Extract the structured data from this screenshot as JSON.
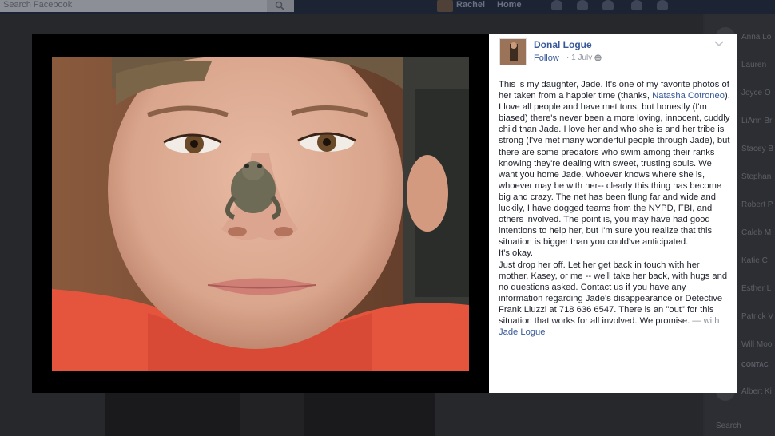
{
  "topbar": {
    "search_placeholder": "Search Facebook",
    "user_name": "Rachel",
    "home_label": "Home"
  },
  "post": {
    "author": "Donal Logue",
    "follow_label": "Follow",
    "date": "· 1 July ·",
    "paragraph1_before_mention": "This is my daughter, Jade. It's one of my favorite photos of her taken from a happier time (thanks, ",
    "mention": "Natasha Cotroneo",
    "paragraph1_after_mention": "). I love all people and have met tons, but honestly (I'm biased) there's never been a more loving, innocent, cuddly child than Jade. I love her and who she is and her tribe is strong (I've met many wonderful people through Jade), but there are some predators who swim among their ranks knowing they're dealing with sweet, trusting souls. We want you home Jade. Whoever knows where she is, whoever may be with her-- clearly this thing has become big and crazy. The net has been flung far and wide and luckily, I have dogged teams from the NYPD, FBI, and others involved. The point is, you may have had good intentions to help her, but I'm sure you realize that this situation is bigger than you could've anticipated.",
    "paragraph2": "It's okay.",
    "paragraph3": "Just drop her off. Let her get back in touch with her mother, Kasey, or me -- we'll take her back, with hugs and no questions asked. Contact us if you have any information regarding Jade's disappearance or Detective Frank Liuzzi at 718 636 6547. There is an \"out\" for this situation that works for all involved. We promise.",
    "with_prefix": " — with ",
    "tagged": "Jade Logue"
  },
  "chat": {
    "contacts": [
      "Anna Lo",
      "Lauren",
      "Joyce O",
      "LiAnn Br",
      "Stacey B",
      "Stephan",
      "Robert P",
      "Caleb M",
      "Katie C",
      "Esther L",
      "Patrick V",
      "Will Moo",
      "Albert Ki"
    ],
    "contacts_header": "CONTAC",
    "search_label": "Search"
  },
  "colors": {
    "link_blue": "#365899",
    "text": "#1d2129",
    "meta_grey": "#90949c"
  }
}
